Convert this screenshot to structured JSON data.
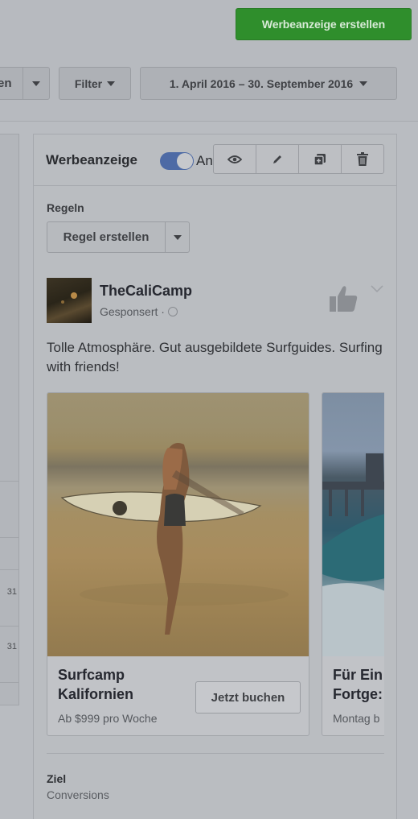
{
  "header": {
    "create_ad_label": "Werbeanzeige erstellen"
  },
  "toolbar": {
    "cut_dropdown_text": "en",
    "filter_label": "Filter",
    "date_range": "1. April 2016 – 30. September 2016"
  },
  "left_panel": {
    "values": [
      "31",
      "31"
    ]
  },
  "panel": {
    "title": "Werbeanzeige",
    "toggle_label": "An",
    "toggle_on": true,
    "actions": [
      "eye-icon",
      "pencil-icon",
      "duplicate-icon",
      "trash-icon"
    ],
    "rules_label": "Regeln",
    "create_rule_label": "Regel erstellen"
  },
  "post": {
    "page_name": "TheCaliCamp",
    "sponsored": "Gesponsert ·",
    "text": "Tolle Atmosphäre. Gut ausgebildete Surfguides. Surfing with friends!"
  },
  "cards": [
    {
      "title_line1": "Surfcamp",
      "title_line2": "Kalifornien",
      "subtitle": "Ab $999 pro Woche",
      "cta": "Jetzt buchen"
    },
    {
      "title_line1": "Für Ein",
      "title_line2": "Fortge:",
      "subtitle": "Montag b"
    }
  ],
  "goal": {
    "label": "Ziel",
    "value": "Conversions"
  },
  "colors": {
    "create_button": "#2f8e2c",
    "toggle_on": "#4d6aa5",
    "overlay_background": "#b9bcc1"
  }
}
